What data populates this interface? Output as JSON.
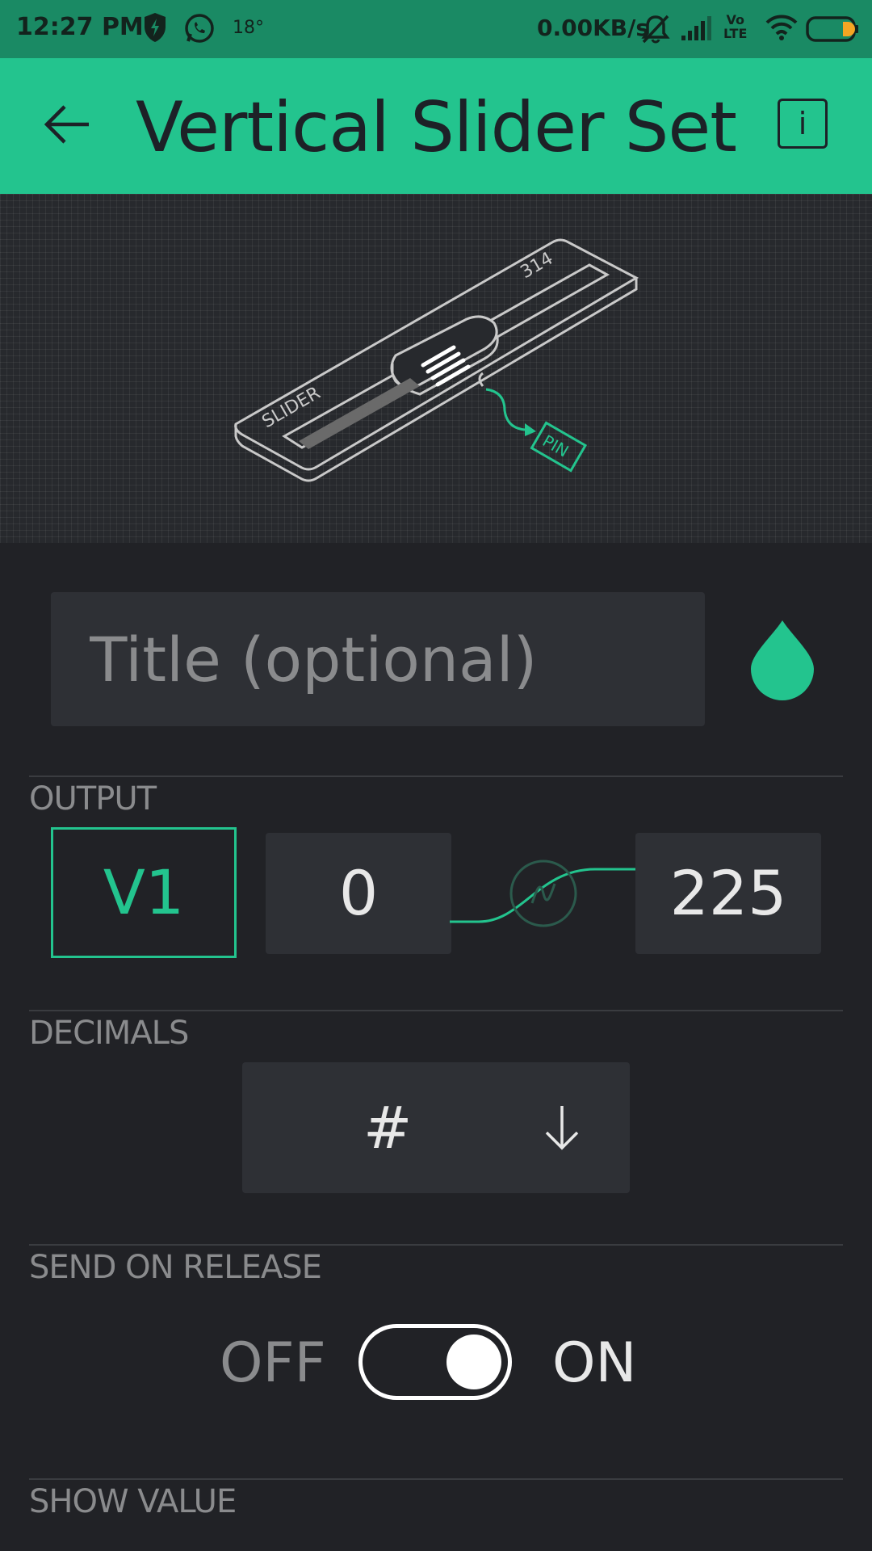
{
  "status_bar": {
    "time": "12:27 PM",
    "temperature": "18°",
    "network_speed": "0.00KB/s",
    "volte_line1": "Vo",
    "volte_line2": "LTE",
    "icons": [
      "shield-bolt-icon",
      "whatsapp-icon",
      "mute-icon",
      "signal-icon",
      "wifi-icon",
      "battery-icon"
    ]
  },
  "app_bar": {
    "title": "Vertical Slider Set",
    "info_label": "i"
  },
  "illustration": {
    "slider_label": "SLIDER",
    "value_label": "314",
    "pin_label": "PIN"
  },
  "title_field": {
    "placeholder": "Title (optional)",
    "value": ""
  },
  "output": {
    "label": "OUTPUT",
    "pin": "V1",
    "min": "0",
    "max": "225"
  },
  "decimals": {
    "label": "DECIMALS",
    "value": "#"
  },
  "send_on_release": {
    "label": "SEND ON RELEASE",
    "off_label": "OFF",
    "on_label": "ON",
    "state": "on"
  },
  "show_value": {
    "label": "SHOW VALUE"
  },
  "colors": {
    "accent": "#23c48e",
    "background": "#212226",
    "field": "#2e3035"
  }
}
